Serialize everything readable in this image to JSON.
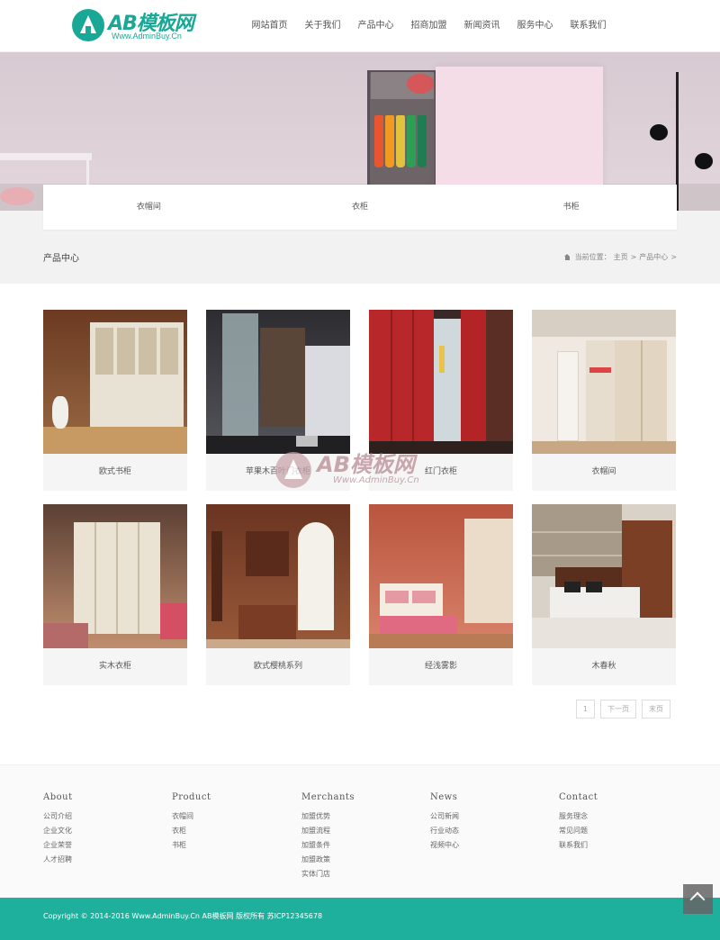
{
  "brand": {
    "logo_text": "AB模板网",
    "logo_sub": "Www.AdminBuy.Cn",
    "accent": "#1eb09d"
  },
  "nav": {
    "items": [
      "网站首页",
      "关于我们",
      "产品中心",
      "招商加盟",
      "新闻资讯",
      "服务中心",
      "联系我们"
    ]
  },
  "subtabs": [
    "衣帽间",
    "衣柜",
    "书柜"
  ],
  "location": {
    "title": "产品中心",
    "prefix": "当前位置：",
    "home": "主页",
    "sep": ">",
    "current": "产品中心",
    "tail": ">"
  },
  "products": [
    {
      "name": "欧式书柜",
      "image": "bookcase-white"
    },
    {
      "name": "苹果木百叶门衣柜",
      "image": "glass-wardrobe"
    },
    {
      "name": "红门衣柜",
      "image": "red-wardrobe"
    },
    {
      "name": "衣帽间",
      "image": "sliding-wardrobe"
    },
    {
      "name": "实木衣柜",
      "image": "solid-wood-wardrobe"
    },
    {
      "name": "欧式樱桃系列",
      "image": "cherry-walkin"
    },
    {
      "name": "经浅雾影",
      "image": "bedroom-pink"
    },
    {
      "name": "木春秋",
      "image": "bedroom-wood"
    }
  ],
  "watermark": {
    "text": "AB模板网",
    "sub": "Www.AdminBuy.Cn"
  },
  "pager": {
    "current": "1",
    "next": "下一页",
    "last": "末页"
  },
  "footer": {
    "columns": [
      {
        "title": "About",
        "links": [
          "公司介绍",
          "企业文化",
          "企业荣誉",
          "人才招聘"
        ]
      },
      {
        "title": "Product",
        "links": [
          "衣帽间",
          "衣柜",
          "书柜"
        ]
      },
      {
        "title": "Merchants",
        "links": [
          "加盟优势",
          "加盟流程",
          "加盟条件",
          "加盟政策",
          "实体门店"
        ]
      },
      {
        "title": "News",
        "links": [
          "公司新闻",
          "行业动态",
          "视频中心"
        ]
      },
      {
        "title": "Contact",
        "links": [
          "服务理念",
          "常见问题",
          "联系我们"
        ]
      }
    ],
    "copyright": "Copyright © 2014-2016 Www.AdminBuy.Cn AB模板网 版权所有 苏ICP12345678"
  }
}
